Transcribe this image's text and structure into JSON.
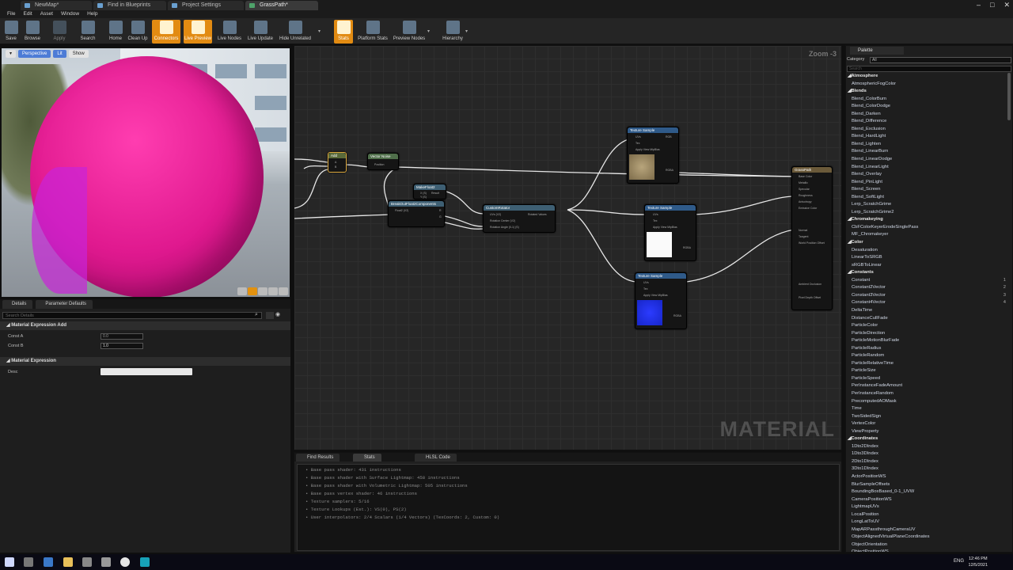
{
  "tabs": [
    {
      "label": "NewMap*",
      "active": false
    },
    {
      "label": "Find in Blueprints",
      "active": false
    },
    {
      "label": "Project Settings",
      "active": false
    },
    {
      "label": "GrassPath*",
      "active": true
    }
  ],
  "menu": [
    "File",
    "Edit",
    "Asset",
    "Window",
    "Help"
  ],
  "toolbar": [
    {
      "label": "Save",
      "icon": "save-icon",
      "state": "normal"
    },
    {
      "label": "Browse",
      "icon": "browse-icon",
      "state": "normal"
    },
    {
      "label": "Apply",
      "icon": "apply-icon",
      "state": "disabled"
    },
    {
      "label": "Search",
      "icon": "search-icon",
      "state": "normal"
    },
    {
      "label": "Home",
      "icon": "home-icon",
      "state": "normal"
    },
    {
      "label": "Clean Up",
      "icon": "cleanup-icon",
      "state": "normal"
    },
    {
      "label": "Connectors",
      "icon": "connectors-icon",
      "state": "active"
    },
    {
      "label": "Live Preview",
      "icon": "live-preview-icon",
      "state": "active"
    },
    {
      "label": "Live Nodes",
      "icon": "live-nodes-icon",
      "state": "normal"
    },
    {
      "label": "Live Update",
      "icon": "live-update-icon",
      "state": "normal"
    },
    {
      "label": "Hide Unrelated",
      "icon": "hide-unrelated-icon",
      "state": "normal"
    },
    {
      "label": "Stats",
      "icon": "stats-icon",
      "state": "active"
    },
    {
      "label": "Platform Stats",
      "icon": "platform-stats-icon",
      "state": "normal"
    },
    {
      "label": "Preview Nodes",
      "icon": "preview-nodes-icon",
      "state": "normal"
    },
    {
      "label": "Hierarchy",
      "icon": "hierarchy-icon",
      "state": "normal"
    }
  ],
  "viewport": {
    "perspective": "Perspective",
    "lit": "Lit",
    "show": "Show"
  },
  "details": {
    "tab1": "Details",
    "tab2": "Parameter Defaults",
    "search_placeholder": "Search Details",
    "section1": "Material Expression Add",
    "const_a_label": "Const A",
    "const_a_value": "0.0",
    "const_b_label": "Const B",
    "const_b_value": "1.0",
    "section2": "Material Expression",
    "desc_label": "Desc"
  },
  "graph": {
    "zoom": "Zoom -3",
    "watermark": "MATERIAL",
    "nodes": {
      "add": "Add",
      "vector_noise": "Vector Noise",
      "make_float2": "MakeFloat2",
      "break_out": "BreakOutFloat2Components",
      "custom_rotator": "CustomRotator",
      "tex1": "Texture Sample",
      "tex2": "Texture Sample",
      "tex3": "Texture Sample",
      "result": "GrassPath"
    },
    "pins": {
      "add_a": "A",
      "add_b": "B",
      "vn_position": "Position",
      "mf_x": "X (S)",
      "mf_y": "Y (S)",
      "mf_result": "Result",
      "bo_float2": "Float2 (V2)",
      "bo_r": "R",
      "bo_g": "G",
      "cr_uvs": "UVs (V2)",
      "cr_center": "Rotation Center (V2)",
      "cr_angle": "Rotation Angle (0-1) (S)",
      "cr_rotated": "Rotated Values",
      "ts_uvs": "UVs",
      "ts_tex": "Tex",
      "ts_apply": "Apply View MipBias",
      "ts_rgb": "RGB",
      "ts_r": "R",
      "ts_g": "G",
      "ts_b": "B",
      "ts_a": "A",
      "ts_rgba": "RGBA",
      "res_base": "Base Color",
      "res_metallic": "Metallic",
      "res_specular": "Specular",
      "res_roughness": "Roughness",
      "res_anisotropy": "Anisotropy",
      "res_emissive": "Emissive Color",
      "res_normal": "Normal",
      "res_tangent": "Tangent",
      "res_wpo": "World Position Offset",
      "res_ao": "Ambient Occlusion",
      "res_pdo": "Pixel Depth Offset"
    }
  },
  "bottom": {
    "tab1": "Find Results",
    "tab2": "Stats",
    "tab3": "HLSL Code",
    "stats": [
      "• Base pass shader: 431 instructions",
      "• Base pass shader with Surface Lightmap: 458 instructions",
      "• Base pass shader with Volumetric Lightmap: 505 instructions",
      "• Base pass vertex shader: 46 instructions",
      "• Texture samplers: 5/16",
      "• Texture Lookups (Est.): VS(0), PS(2)",
      "• User interpolators: 2/4 Scalars (1/4 Vectors) (TexCoords: 2, Custom: 0)"
    ]
  },
  "palette": {
    "tab": "Palette",
    "category_label": "Category",
    "category_value": "All",
    "search_placeholder": "Search",
    "items": [
      {
        "t": "Atmosphere",
        "cat": true
      },
      {
        "t": "AtmosphericFogColor"
      },
      {
        "t": "Blends",
        "cat": true
      },
      {
        "t": "Blend_ColorBurn"
      },
      {
        "t": "Blend_ColorDodge"
      },
      {
        "t": "Blend_Darken"
      },
      {
        "t": "Blend_Difference"
      },
      {
        "t": "Blend_Exclusion"
      },
      {
        "t": "Blend_HardLight"
      },
      {
        "t": "Blend_Lighten"
      },
      {
        "t": "Blend_LinearBurn"
      },
      {
        "t": "Blend_LinearDodge"
      },
      {
        "t": "Blend_LinearLight"
      },
      {
        "t": "Blend_Overlay"
      },
      {
        "t": "Blend_PinLight"
      },
      {
        "t": "Blend_Screen"
      },
      {
        "t": "Blend_SoftLight"
      },
      {
        "t": "Lerp_ScratchGrime"
      },
      {
        "t": "Lerp_ScratchGrime2"
      },
      {
        "t": "Chromakeying",
        "cat": true
      },
      {
        "t": "CbFColorKeyerErodeSinglePass"
      },
      {
        "t": "MF_Chromakeyer"
      },
      {
        "t": "Color",
        "cat": true
      },
      {
        "t": "Desaturation"
      },
      {
        "t": "LinearToSRGB"
      },
      {
        "t": "sRGBToLinear"
      },
      {
        "t": "Constants",
        "cat": true
      },
      {
        "t": "Constant",
        "sc": "1"
      },
      {
        "t": "Constant2Vector",
        "sc": "2"
      },
      {
        "t": "Constant3Vector",
        "sc": "3"
      },
      {
        "t": "Constant4Vector",
        "sc": "4"
      },
      {
        "t": "DeltaTime"
      },
      {
        "t": "DistanceCullFade"
      },
      {
        "t": "ParticleColor"
      },
      {
        "t": "ParticleDirection"
      },
      {
        "t": "ParticleMotionBlurFade"
      },
      {
        "t": "ParticleRadius"
      },
      {
        "t": "ParticleRandom"
      },
      {
        "t": "ParticleRelativeTime"
      },
      {
        "t": "ParticleSize"
      },
      {
        "t": "ParticleSpeed"
      },
      {
        "t": "PerInstanceFadeAmount"
      },
      {
        "t": "PerInstanceRandom"
      },
      {
        "t": "PrecomputedAOMask"
      },
      {
        "t": "Time"
      },
      {
        "t": "TwoSidedSign"
      },
      {
        "t": "VertexColor"
      },
      {
        "t": "ViewProperty"
      },
      {
        "t": "Coordinates",
        "cat": true
      },
      {
        "t": "1Dto2DIndex"
      },
      {
        "t": "1Dto3DIndex"
      },
      {
        "t": "2Dto1DIndex"
      },
      {
        "t": "3Dto1DIndex"
      },
      {
        "t": "ActorPositionWS"
      },
      {
        "t": "BlurSampleOffsets"
      },
      {
        "t": "BoundingBoxBased_0-1_UVW"
      },
      {
        "t": "CameraPositionWS"
      },
      {
        "t": "LightmapUVs"
      },
      {
        "t": "LocalPosition"
      },
      {
        "t": "LongLatToUV"
      },
      {
        "t": "MapARPassthroughCameraUV"
      },
      {
        "t": "ObjectAlignedVirtualPlaneCoordinates"
      },
      {
        "t": "ObjectOrientation"
      },
      {
        "t": "ObjectPositionWS"
      }
    ]
  },
  "taskbar": {
    "lang": "ENG",
    "time": "12:46 PM",
    "date": "12/5/2021"
  },
  "colors": {
    "accent": "#e28b12",
    "sphere": "#e0198f",
    "graph_bg": "#262626"
  }
}
